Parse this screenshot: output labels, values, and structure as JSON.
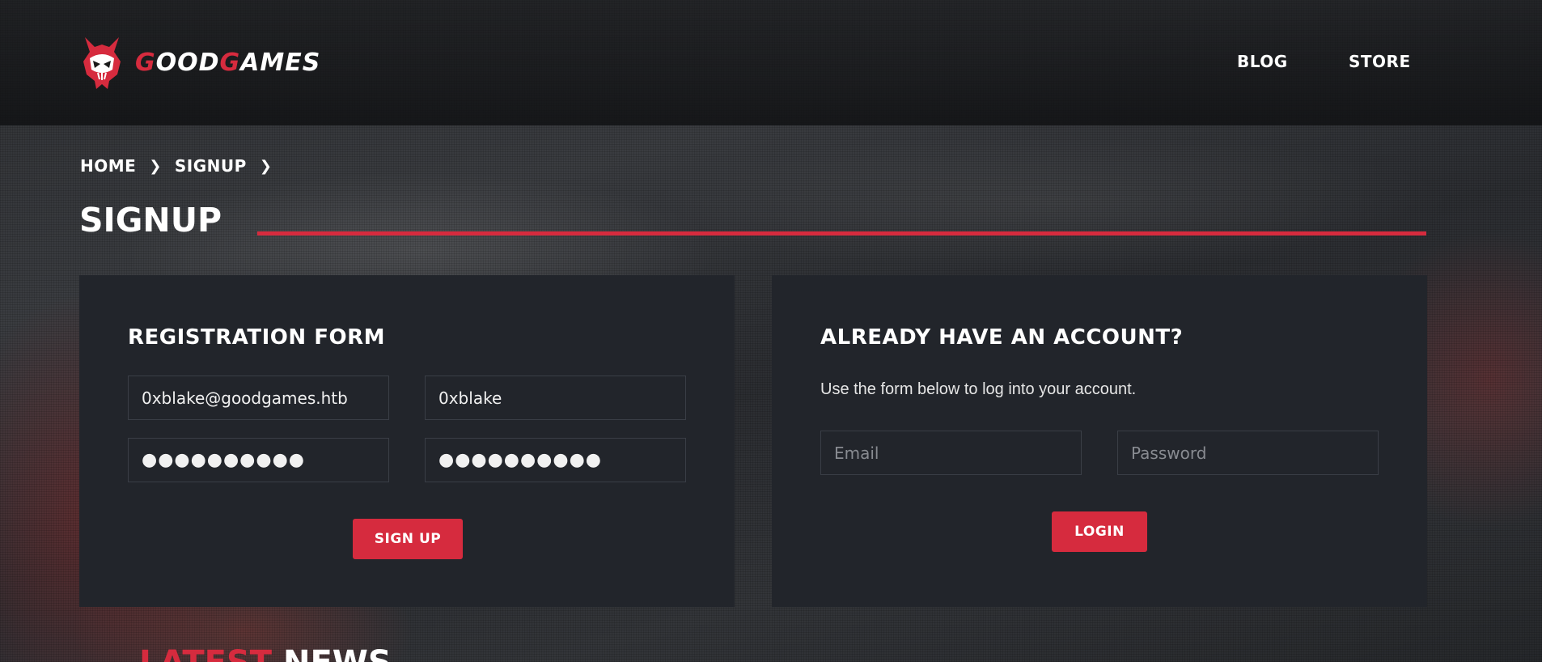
{
  "brand": {
    "name_first_initial": "G",
    "name_first_rest": "OOD",
    "name_second_initial": "G",
    "name_second_rest": "AMES",
    "accent_color": "#d62b3e"
  },
  "nav": {
    "blog": "BLOG",
    "store": "STORE"
  },
  "breadcrumb": {
    "home": "HOME",
    "signup": "SIGNUP"
  },
  "page": {
    "title": "SIGNUP"
  },
  "registration": {
    "heading": "REGISTRATION FORM",
    "email_value": "0xblake@goodgames.htb",
    "username_value": "0xblake",
    "password_mask": "●●●●●●●●●●",
    "password_confirm_mask": "●●●●●●●●●●",
    "submit_label": "SIGN UP"
  },
  "login": {
    "heading": "ALREADY HAVE AN ACCOUNT?",
    "description": "Use the form below to log into your account.",
    "email_placeholder": "Email",
    "password_placeholder": "Password",
    "submit_label": "LOGIN"
  },
  "news": {
    "accent_word": "LATEST",
    "word": "NEWS"
  },
  "icons": {
    "logo": "demon-skull-icon",
    "breadcrumb_separator": "chevron-right-icon"
  }
}
